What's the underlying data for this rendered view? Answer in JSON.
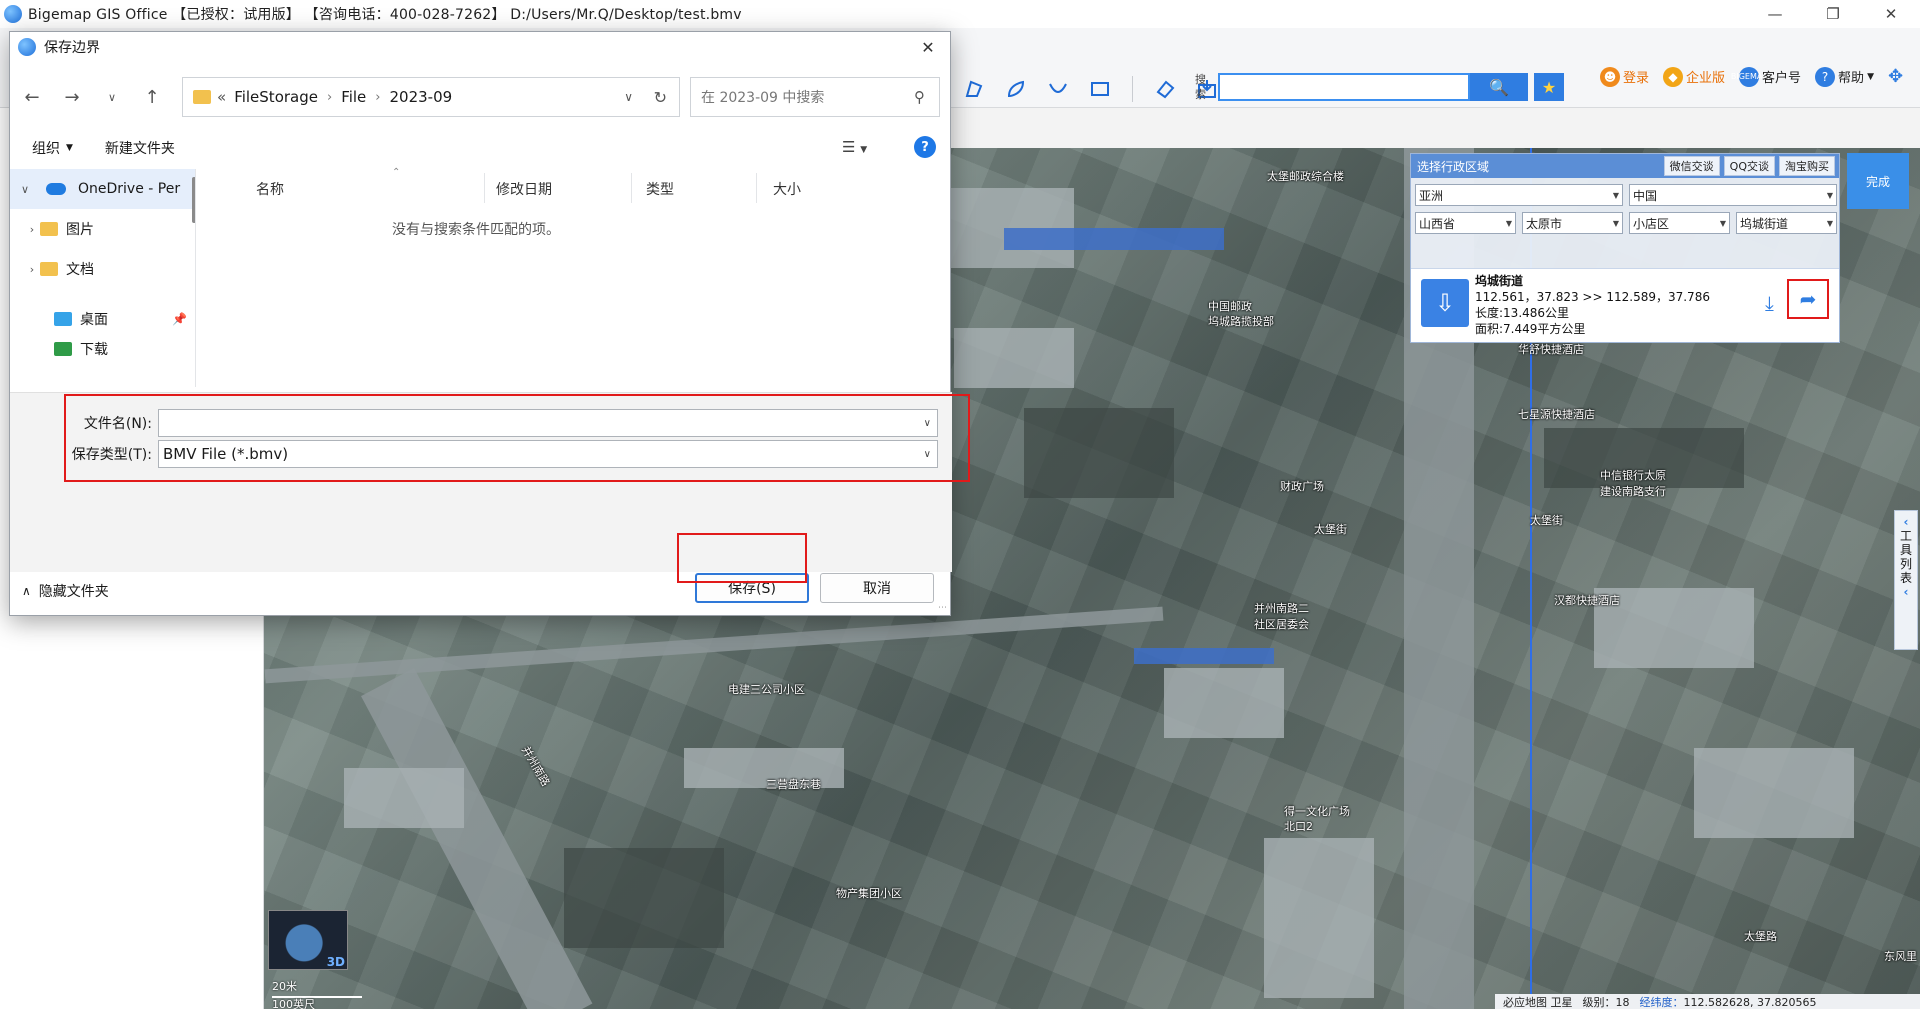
{
  "app": {
    "title": "Bigemap GIS Office 【已授权：试用版】 【咨询电话：400-028-7262】 D:/Users/Mr.Q/Desktop/test.bmv",
    "window_controls": [
      "—",
      "❐",
      "✕"
    ]
  },
  "top_links": {
    "login": "登录",
    "enterprise": "企业版",
    "customer": "客户号",
    "help": "帮助",
    "cust_icon_text": "BIGEMAP"
  },
  "toolbar": {
    "search_label": "搜索",
    "search_value": ""
  },
  "admin_panel": {
    "title": "选择行政区域",
    "links": [
      "微信交谈",
      "QQ交谈",
      "淘宝购买"
    ],
    "continent": "亚洲",
    "country": "中国",
    "province": "山西省",
    "city": "太原市",
    "district": "小店区",
    "street": "坞城街道",
    "info_name": "坞城街道",
    "info_coords": "112.561，37.823 >> 112.589，37.786",
    "info_length": "长度:13.486公里",
    "info_area": "面积:7.449平方公里",
    "finish_label": "完成"
  },
  "tools_side": {
    "label": [
      "工",
      "具",
      "列",
      "表"
    ]
  },
  "map_labels": [
    "太堡邮政综合楼",
    "中国邮政",
    "坞城路揽投部",
    "华舒快捷酒店",
    "七星源快捷酒店",
    "中信银行太原",
    "建设南路支行",
    "太堡街",
    "汉都快捷酒店",
    "并州南路二",
    "社区居委会",
    "财政广场",
    "太堡街",
    "电建三公司小区",
    "三营盘东巷",
    "物产集团小区",
    "得一文化广场",
    "北口2",
    "并州南路",
    "太堡路",
    "东风里"
  ],
  "statusbar": {
    "map_type": "必应地图 卫星",
    "level_label": "级别：",
    "level_value": "18",
    "lon_label": "经纬度：",
    "coords": "112.582628, 37.820565"
  },
  "mini_map": {
    "label_3d": "3D",
    "scale_small": "20米",
    "scale_big": "100英尺"
  },
  "dialog": {
    "title": "保存边界",
    "close": "✕",
    "breadcrumb": [
      "FileStorage",
      "File",
      "2023-09"
    ],
    "breadcrumb_prefix": "«",
    "search_placeholder": "在 2023-09 中搜索",
    "cmd_organize": "组织",
    "cmd_new_folder": "新建文件夹",
    "help_icon_text": "?",
    "tree": [
      {
        "label": "OneDrive - Per",
        "type": "cloud"
      },
      {
        "label": "图片",
        "type": "folder"
      },
      {
        "label": "文档",
        "type": "folder"
      },
      {
        "label": "桌面",
        "type": "desktop"
      },
      {
        "label": "下载",
        "type": "download"
      }
    ],
    "columns": [
      "名称",
      "修改日期",
      "类型",
      "大小"
    ],
    "empty_message": "没有与搜索条件匹配的项。",
    "filename_label": "文件名(N):",
    "filename_value": "",
    "filetype_label": "保存类型(T):",
    "filetype_value": "BMV File (*.bmv)",
    "hide_folders": "隐藏文件夹",
    "save_button": "保存(S)",
    "cancel_button": "取消"
  },
  "colors": {
    "accent": "#2f7de1",
    "highlight_red": "#e11a1a",
    "admin_header": "#5b8ed6"
  }
}
